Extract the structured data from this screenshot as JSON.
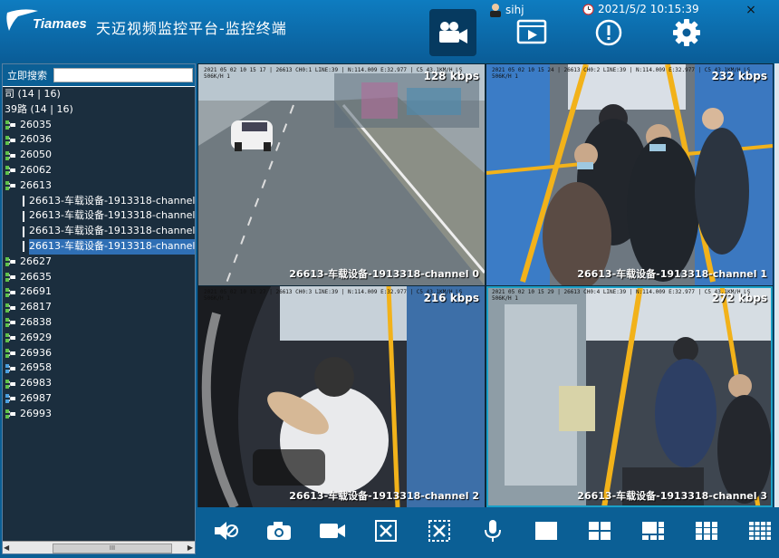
{
  "header": {
    "brand": "Tiamaes",
    "title": "天迈视频监控平台-监控终端",
    "user": "sihj",
    "datetime": "2021/5/2 10:15:39",
    "close": "×",
    "nav": [
      "video-icon",
      "playback-icon",
      "alarm-icon",
      "settings-icon"
    ]
  },
  "search": {
    "button": "立即搜索",
    "value": ""
  },
  "tree": {
    "items": [
      {
        "label": "司 (14 | 16)",
        "type": "text",
        "indent": 0
      },
      {
        "label": "39路 (14 | 16)",
        "type": "text",
        "indent": 0
      },
      {
        "label": "26035",
        "type": "bus",
        "indent": 0
      },
      {
        "label": "26036",
        "type": "bus",
        "indent": 0
      },
      {
        "label": "26050",
        "type": "bus",
        "indent": 0
      },
      {
        "label": "26062",
        "type": "bus",
        "indent": 0
      },
      {
        "label": "26613",
        "type": "bus",
        "indent": 0
      },
      {
        "label": "26613-车载设备-1913318-channel 0",
        "type": "channel",
        "indent": 1
      },
      {
        "label": "26613-车载设备-1913318-channel 1",
        "type": "channel",
        "indent": 1
      },
      {
        "label": "26613-车载设备-1913318-channel 2",
        "type": "channel",
        "indent": 1
      },
      {
        "label": "26613-车载设备-1913318-channel 3",
        "type": "channel",
        "indent": 1,
        "selected": true
      },
      {
        "label": "26627",
        "type": "bus",
        "indent": 0
      },
      {
        "label": "26635",
        "type": "bus",
        "indent": 0
      },
      {
        "label": "26691",
        "type": "bus",
        "indent": 0
      },
      {
        "label": "26817",
        "type": "bus",
        "indent": 0
      },
      {
        "label": "26838",
        "type": "bus",
        "indent": 0
      },
      {
        "label": "26929",
        "type": "bus",
        "indent": 0
      },
      {
        "label": "26936",
        "type": "bus",
        "indent": 0
      },
      {
        "label": "26958",
        "type": "bus-alt",
        "indent": 0
      },
      {
        "label": "26983",
        "type": "bus",
        "indent": 0
      },
      {
        "label": "26987",
        "type": "bus-alt",
        "indent": 0
      },
      {
        "label": "26993",
        "type": "bus",
        "indent": 0
      }
    ]
  },
  "scrollbar": {
    "thumb": "III"
  },
  "videos": [
    {
      "kbps": "128 kbps",
      "name": "26613-车载设备-1913318-channel 0",
      "osd": "2021 05 02 10 15 17 | 26613 CH0:1 LINE:39 | N:114.009 E:32.977 | C5 43.1KM/H LS 506K/H 1"
    },
    {
      "kbps": "232 kbps",
      "name": "26613-车载设备-1913318-channel 1",
      "osd": "2021 05 02 10 15 24 | 26613 CH0:2 LINE:39 | N:114.009 E:32.977 | C5 43.1KM/H LS 506K/H 1"
    },
    {
      "kbps": "216 kbps",
      "name": "26613-车载设备-1913318-channel 2",
      "osd": "2021 05 02 10 15 27 | 26613 CH0:3 LINE:39 | N:114.009 E:32.977 | C5 43.1KM/H LS 506K/H 1"
    },
    {
      "kbps": "272 kbps",
      "name": "26613-车载设备-1913318-channel 3",
      "osd": "2021 05 02 10 15 29 | 26613 CH0:4 LINE:39 | N:114.009 E:32.977 | C5 43.1KM/H LS 506K/H 1"
    }
  ],
  "toolbar": [
    "mute-icon",
    "snapshot-icon",
    "record-icon",
    "close-channel-icon",
    "close-all-icon",
    "talk-icon",
    "layout-1-icon",
    "layout-4-icon",
    "layout-6-icon",
    "layout-9-icon",
    "layout-16-icon"
  ],
  "colors": {
    "accent": "#0b5f95",
    "selected": "#2f6fb5",
    "channel": "#cc2222",
    "activeCell": "#1aa0c8"
  }
}
